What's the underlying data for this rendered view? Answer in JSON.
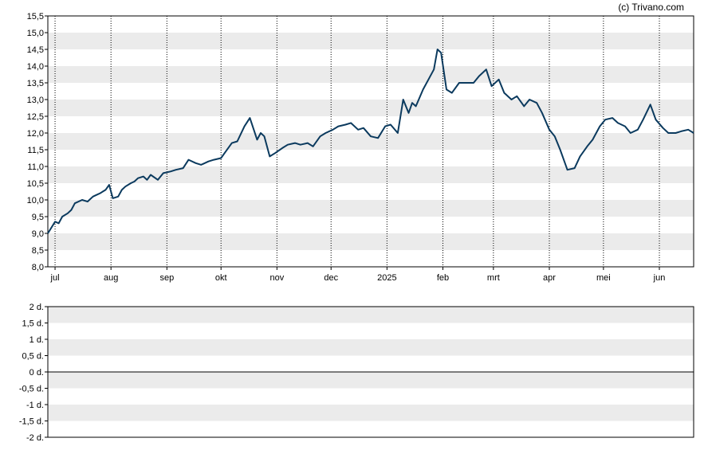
{
  "copyright": "(c) Trivano.com",
  "colors": {
    "line": "#0b3a5e",
    "band": "#ebebeb",
    "axis": "#000000",
    "gridline": "#000000"
  },
  "chart_data": [
    {
      "type": "line",
      "ylim": [
        8.0,
        15.5
      ],
      "y_ticks": [
        "8,0",
        "8,5",
        "9,0",
        "9,5",
        "10,0",
        "10,5",
        "11,0",
        "11,5",
        "12,0",
        "12,5",
        "13,0",
        "13,5",
        "14,0",
        "14,5",
        "15,0",
        "15,5"
      ],
      "y_tick_values": [
        8.0,
        8.5,
        9.0,
        9.5,
        10.0,
        10.5,
        11.0,
        11.5,
        12.0,
        12.5,
        13.0,
        13.5,
        14.0,
        14.5,
        15.0,
        15.5
      ],
      "x_range": [
        "2024-06-27",
        "2025-06-20"
      ],
      "x_ticks": [
        {
          "label": "jul",
          "date": "2024-07-01"
        },
        {
          "label": "aug",
          "date": "2024-08-01"
        },
        {
          "label": "sep",
          "date": "2024-09-01"
        },
        {
          "label": "okt",
          "date": "2024-10-01"
        },
        {
          "label": "nov",
          "date": "2024-11-01"
        },
        {
          "label": "dec",
          "date": "2024-12-01"
        },
        {
          "label": "2025",
          "date": "2025-01-01"
        },
        {
          "label": "feb",
          "date": "2025-02-01"
        },
        {
          "label": "mrt",
          "date": "2025-03-01"
        },
        {
          "label": "apr",
          "date": "2025-04-01"
        },
        {
          "label": "mei",
          "date": "2025-05-01"
        },
        {
          "label": "jun",
          "date": "2025-06-01"
        }
      ],
      "grid": "vertical dotted lines at month starts, alternating grey horizontal bands",
      "series": [
        {
          "x": [
            "2024-06-27",
            "2024-07-01",
            "2024-07-03",
            "2024-07-05",
            "2024-07-08",
            "2024-07-10",
            "2024-07-12",
            "2024-07-16",
            "2024-07-19",
            "2024-07-22",
            "2024-07-24",
            "2024-07-26",
            "2024-07-29",
            "2024-07-31",
            "2024-08-02",
            "2024-08-05",
            "2024-08-07",
            "2024-08-09",
            "2024-08-12",
            "2024-08-14",
            "2024-08-16",
            "2024-08-19",
            "2024-08-21",
            "2024-08-23",
            "2024-08-27",
            "2024-08-30",
            "2024-09-03",
            "2024-09-06",
            "2024-09-10",
            "2024-09-13",
            "2024-09-17",
            "2024-09-20",
            "2024-09-24",
            "2024-09-27",
            "2024-10-01",
            "2024-10-03",
            "2024-10-07",
            "2024-10-10",
            "2024-10-14",
            "2024-10-17",
            "2024-10-21",
            "2024-10-23",
            "2024-10-25",
            "2024-10-28",
            "2024-10-31",
            "2024-11-04",
            "2024-11-07",
            "2024-11-11",
            "2024-11-14",
            "2024-11-18",
            "2024-11-21",
            "2024-11-25",
            "2024-11-28",
            "2024-12-02",
            "2024-12-05",
            "2024-12-09",
            "2024-12-12",
            "2024-12-16",
            "2024-12-19",
            "2024-12-23",
            "2024-12-27",
            "2024-12-31",
            "2025-01-03",
            "2025-01-07",
            "2025-01-10",
            "2025-01-13",
            "2025-01-15",
            "2025-01-17",
            "2025-01-21",
            "2025-01-24",
            "2025-01-27",
            "2025-01-29",
            "2025-01-31",
            "2025-02-03",
            "2025-02-06",
            "2025-02-10",
            "2025-02-14",
            "2025-02-18",
            "2025-02-21",
            "2025-02-25",
            "2025-02-28",
            "2025-03-04",
            "2025-03-07",
            "2025-03-11",
            "2025-03-14",
            "2025-03-18",
            "2025-03-21",
            "2025-03-25",
            "2025-03-28",
            "2025-04-01",
            "2025-04-04",
            "2025-04-07",
            "2025-04-09",
            "2025-04-11",
            "2025-04-15",
            "2025-04-18",
            "2025-04-22",
            "2025-04-25",
            "2025-04-29",
            "2025-05-02",
            "2025-05-06",
            "2025-05-09",
            "2025-05-13",
            "2025-05-16",
            "2025-05-20",
            "2025-05-23",
            "2025-05-27",
            "2025-05-30",
            "2025-06-03",
            "2025-06-06",
            "2025-06-10",
            "2025-06-13",
            "2025-06-17",
            "2025-06-20"
          ],
          "y": [
            9.0,
            9.35,
            9.3,
            9.5,
            9.6,
            9.7,
            9.9,
            10.0,
            9.95,
            10.1,
            10.15,
            10.2,
            10.3,
            10.45,
            10.05,
            10.1,
            10.3,
            10.4,
            10.5,
            10.55,
            10.65,
            10.7,
            10.6,
            10.75,
            10.6,
            10.8,
            10.85,
            10.9,
            10.95,
            11.2,
            11.1,
            11.05,
            11.15,
            11.2,
            11.25,
            11.4,
            11.7,
            11.75,
            12.2,
            12.45,
            11.8,
            12.0,
            11.9,
            11.3,
            11.4,
            11.55,
            11.65,
            11.7,
            11.65,
            11.7,
            11.6,
            11.9,
            12.0,
            12.1,
            12.2,
            12.25,
            12.3,
            12.1,
            12.15,
            11.9,
            11.85,
            12.2,
            12.25,
            12.0,
            13.0,
            12.6,
            12.9,
            12.8,
            13.3,
            13.6,
            13.9,
            14.5,
            14.4,
            13.3,
            13.2,
            13.5,
            13.5,
            13.5,
            13.7,
            13.9,
            13.4,
            13.6,
            13.2,
            13.0,
            13.1,
            12.8,
            13.0,
            12.9,
            12.6,
            12.1,
            11.9,
            11.5,
            11.2,
            10.9,
            10.95,
            11.3,
            11.6,
            11.8,
            12.2,
            12.4,
            12.45,
            12.3,
            12.2,
            12.0,
            12.1,
            12.4,
            12.85,
            12.4,
            12.15,
            12.0,
            12.0,
            12.05,
            12.1,
            12.0
          ]
        }
      ]
    },
    {
      "type": "line",
      "ylim": [
        -2,
        2
      ],
      "y_ticks": [
        "2 d.",
        "1,5 d.",
        "1 d.",
        "0,5 d.",
        "0 d.",
        "-0,5 d.",
        "-1 d.",
        "-1,5 d.",
        "-2 d."
      ],
      "y_tick_values": [
        2,
        1.5,
        1,
        0.5,
        0,
        -0.5,
        -1,
        -1.5,
        -2
      ],
      "baseline": 0,
      "series": []
    }
  ]
}
